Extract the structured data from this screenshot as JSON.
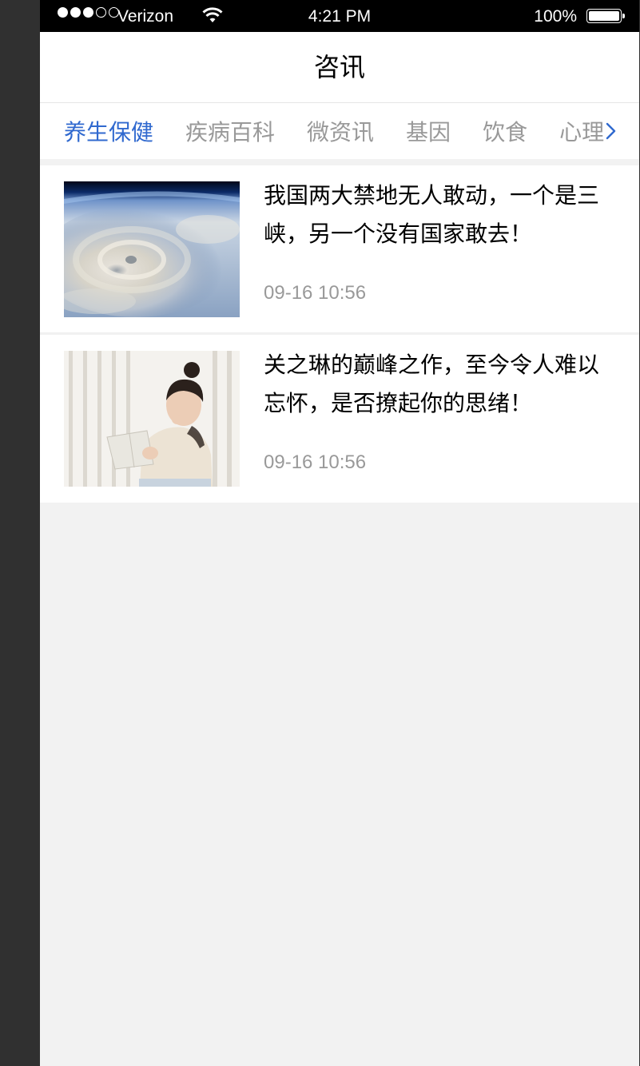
{
  "status_bar": {
    "carrier": "Verizon",
    "time": "4:21 PM",
    "battery": "100%",
    "signal_bars": 3,
    "signal_total": 5
  },
  "nav": {
    "title": "咨讯"
  },
  "tabs": [
    {
      "label": "养生保健",
      "active": true
    },
    {
      "label": "疾病百科",
      "active": false
    },
    {
      "label": "微资讯",
      "active": false
    },
    {
      "label": "基因",
      "active": false
    },
    {
      "label": "饮食",
      "active": false
    },
    {
      "label": "心理",
      "active": false
    }
  ],
  "colors": {
    "active_tab": "#3069cf",
    "inactive_tab": "#999999",
    "headline": "#000000",
    "date": "#999999",
    "page_bg": "#f2f2f2"
  },
  "icons": {
    "more_tabs": "chevron-right-icon",
    "wifi": "wifi-icon",
    "battery": "battery-icon"
  },
  "news": [
    {
      "headline": "我国两大禁地无人敢动，一个是三峡，另一个没有国家敢去！",
      "date": "09-16 10:56",
      "image": "earth-from-space-cyclone"
    },
    {
      "headline": "关之琳的巅峰之作，至今令人难以忘怀，是否撩起你的思绪！",
      "date": "09-16 10:56",
      "image": "woman-reading-book"
    }
  ]
}
